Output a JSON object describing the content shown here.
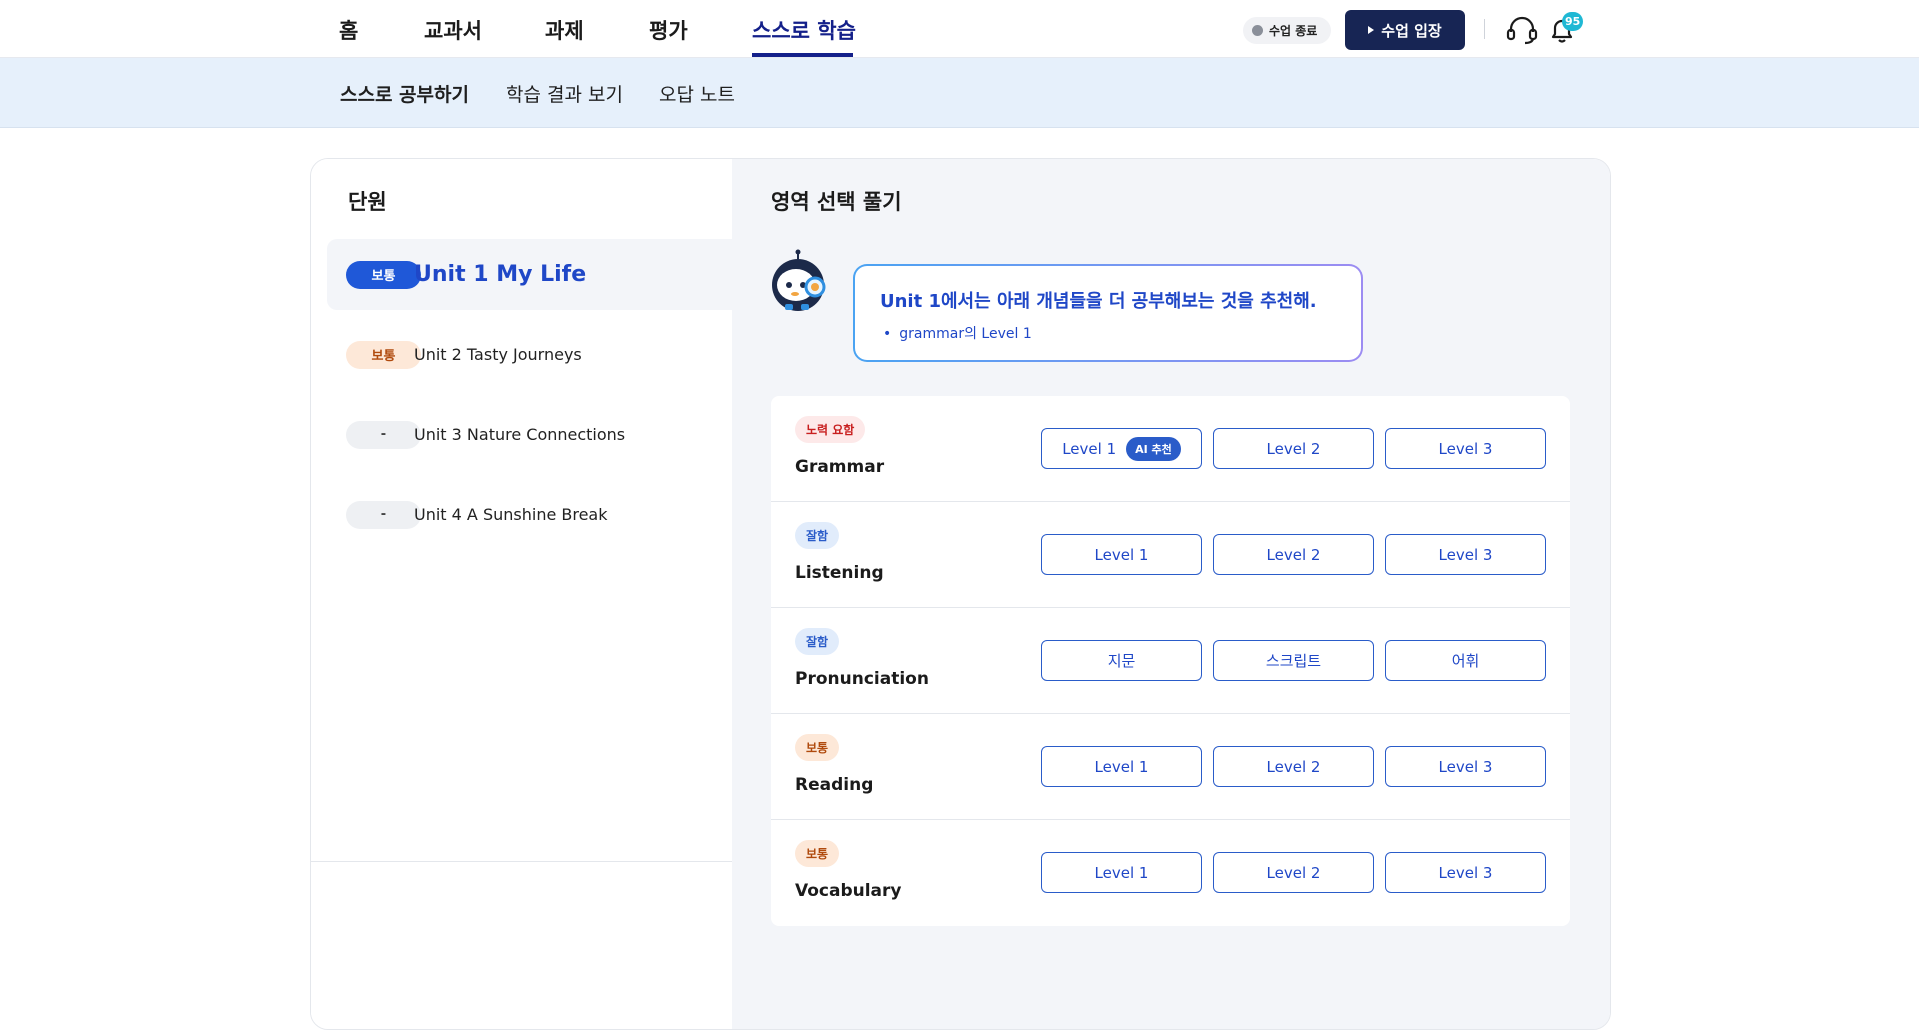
{
  "nav": {
    "items": [
      {
        "label": "홈",
        "active": false
      },
      {
        "label": "교과서",
        "active": false
      },
      {
        "label": "과제",
        "active": false
      },
      {
        "label": "평가",
        "active": false
      },
      {
        "label": "스스로 학습",
        "active": true
      }
    ],
    "class_status": "수업 종료",
    "enter_button": "수업 입장",
    "notification_count": "95",
    "icons": [
      "headset-icon",
      "bell-icon",
      "play-icon"
    ]
  },
  "subnav": {
    "items": [
      {
        "label": "스스로 공부하기",
        "active": true
      },
      {
        "label": "학습 결과 보기",
        "active": false
      },
      {
        "label": "오답 노트",
        "active": false
      }
    ]
  },
  "units": {
    "title": "단원",
    "items": [
      {
        "level": "보통",
        "label": "Unit 1 My Life",
        "selected": true
      },
      {
        "level": "보통",
        "label": "Unit 2 Tasty Journeys",
        "selected": false
      },
      {
        "level": "-",
        "label": "Unit 3 Nature Connections",
        "selected": false
      },
      {
        "level": "-",
        "label": "Unit 4 A Sunshine Break",
        "selected": false
      }
    ]
  },
  "areas": {
    "title": "영역 선택 풀기",
    "recommendation": {
      "title": "Unit 1에서는 아래 개념들을 더 공부해보는 것을 추천해.",
      "items": [
        "grammar의 Level 1"
      ]
    },
    "rows": [
      {
        "status": "노력 요함",
        "name": "Grammar",
        "buttons": [
          {
            "label": "Level 1",
            "ai": "AI 추천"
          },
          {
            "label": "Level 2"
          },
          {
            "label": "Level 3"
          }
        ]
      },
      {
        "status": "잘함",
        "name": "Listening",
        "buttons": [
          {
            "label": "Level 1"
          },
          {
            "label": "Level 2"
          },
          {
            "label": "Level 3"
          }
        ]
      },
      {
        "status": "잘함",
        "name": "Pronunciation",
        "buttons": [
          {
            "label": "지문"
          },
          {
            "label": "스크립트"
          },
          {
            "label": "어휘"
          }
        ]
      },
      {
        "status": "보통",
        "name": "Reading",
        "buttons": [
          {
            "label": "Level 1"
          },
          {
            "label": "Level 2"
          },
          {
            "label": "Level 3"
          }
        ]
      },
      {
        "status": "보통",
        "name": "Vocabulary",
        "buttons": [
          {
            "label": "Level 1"
          },
          {
            "label": "Level 2"
          },
          {
            "label": "Level 3"
          }
        ]
      }
    ]
  },
  "colors": {
    "primary": "#1f47c7",
    "nav_active": "#14208a",
    "subnav_bg": "#e6f0fb",
    "enter_button_bg": "#172554",
    "needs_effort": "#c81f1f",
    "good": "#2a5cc9",
    "average": "#b04a0d"
  }
}
